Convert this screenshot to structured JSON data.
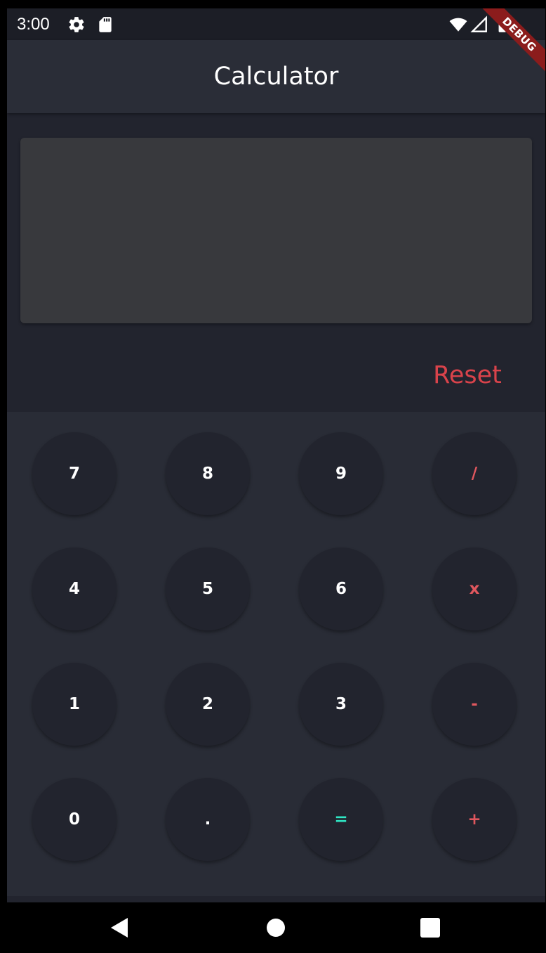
{
  "status_bar": {
    "time": "3:00",
    "icons": [
      "gear-icon",
      "sd-card-icon",
      "wifi-icon",
      "signal-icon",
      "battery-icon"
    ]
  },
  "debug_banner": {
    "label": "DEBUG"
  },
  "app_bar": {
    "title": "Calculator"
  },
  "display": {
    "value": ""
  },
  "reset": {
    "label": "Reset"
  },
  "keypad": {
    "rows": [
      [
        {
          "label": "7"
        },
        {
          "label": "8"
        },
        {
          "label": "9"
        },
        {
          "label": "/"
        }
      ],
      [
        {
          "label": "4"
        },
        {
          "label": "5"
        },
        {
          "label": "6"
        },
        {
          "label": "x"
        }
      ],
      [
        {
          "label": "1"
        },
        {
          "label": "2"
        },
        {
          "label": "3"
        },
        {
          "label": "-"
        }
      ],
      [
        {
          "label": "0"
        },
        {
          "label": "."
        },
        {
          "label": "="
        },
        {
          "label": "+"
        }
      ]
    ]
  },
  "nav_bar": {
    "buttons": [
      "back-icon",
      "home-icon",
      "recents-icon"
    ]
  },
  "colors": {
    "background": "#22242e",
    "app_bar": "#2a2d37",
    "keypad": "#292c36",
    "key": "#22242e",
    "display": "#38393d",
    "operator": "#e0575e",
    "equals": "#2fe6c4",
    "reset": "#d9434b",
    "debug_banner": "#8b1c1c"
  }
}
